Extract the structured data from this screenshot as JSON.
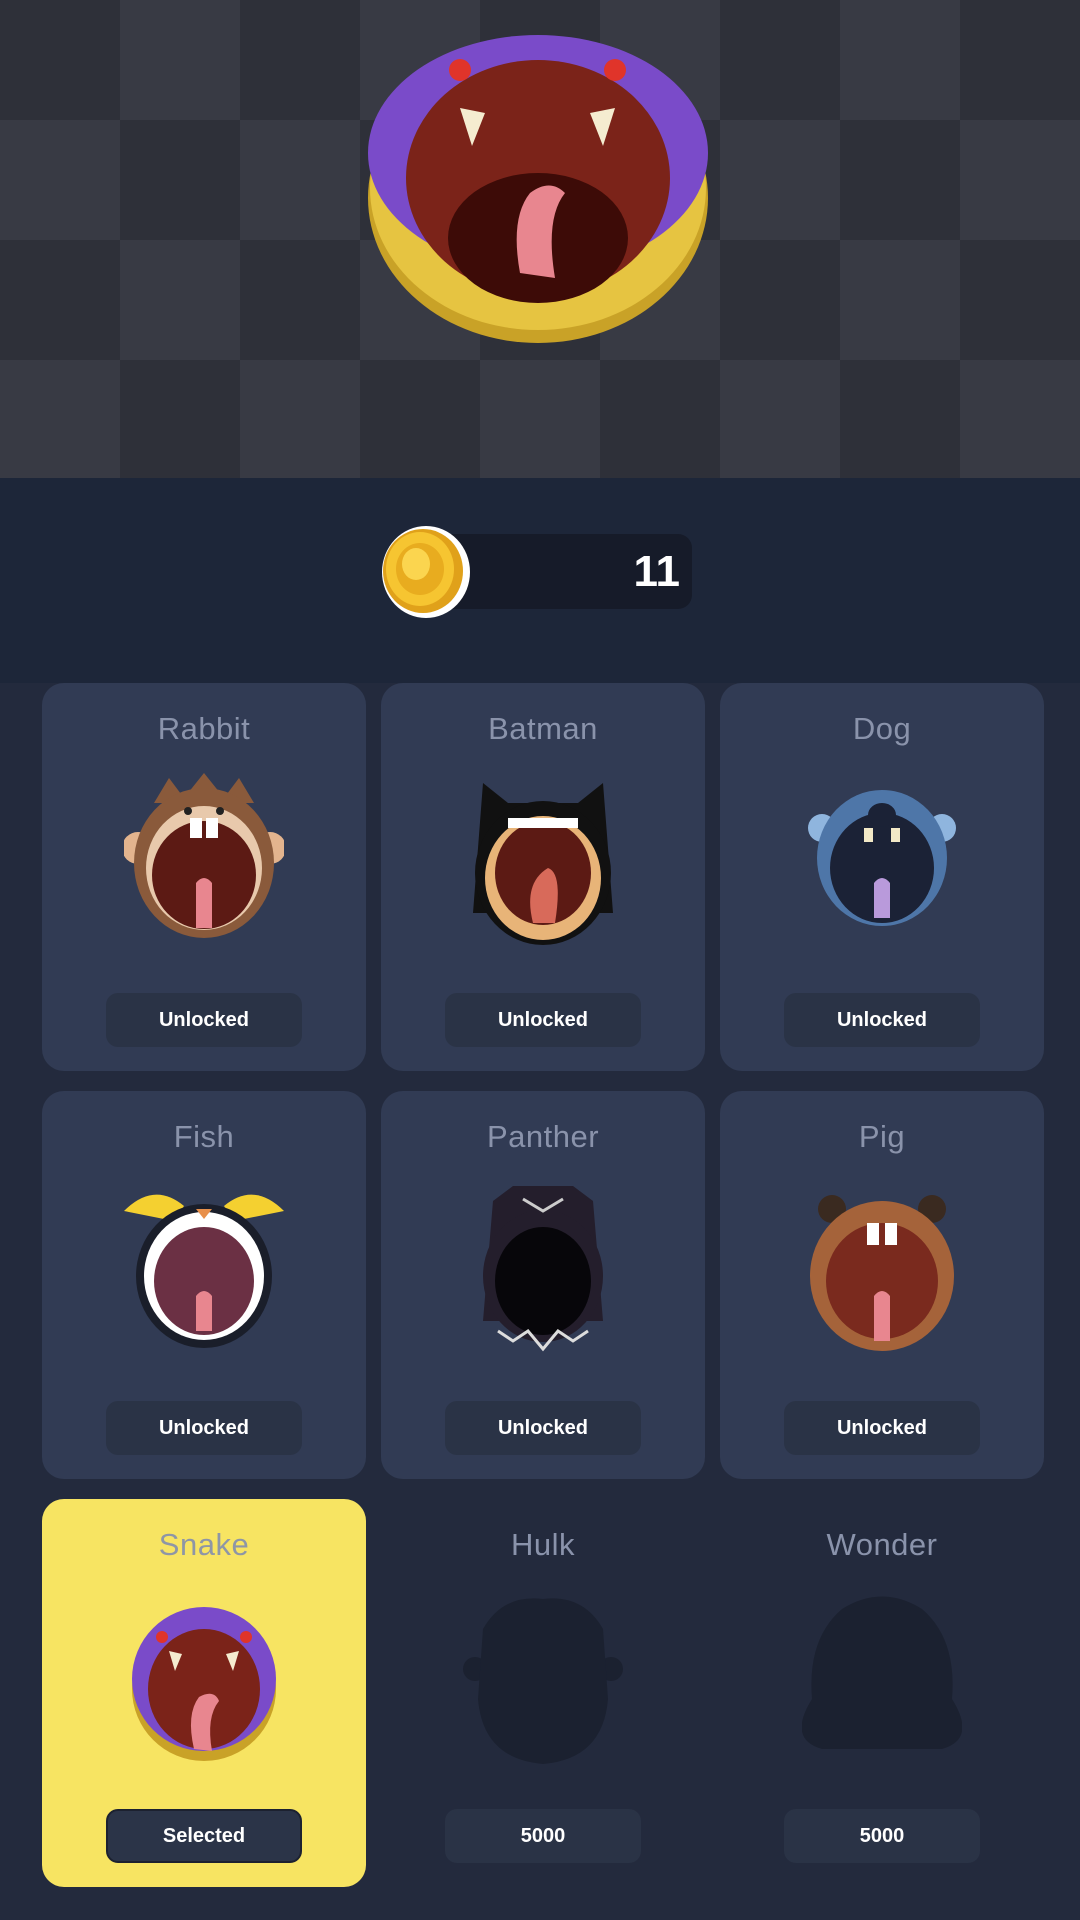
{
  "coins": {
    "value": "11"
  },
  "skins": [
    {
      "name": "Rabbit",
      "status": "Unlocked"
    },
    {
      "name": "Batman",
      "status": "Unlocked"
    },
    {
      "name": "Dog",
      "status": "Unlocked"
    },
    {
      "name": "Fish",
      "status": "Unlocked"
    },
    {
      "name": "Panther",
      "status": "Unlocked"
    },
    {
      "name": "Pig",
      "status": "Unlocked"
    },
    {
      "name": "Snake",
      "status": "Selected"
    },
    {
      "name": "Hulk",
      "status": "5000"
    },
    {
      "name": "Wonder",
      "status": "5000"
    }
  ],
  "colors": {
    "background": "#232a3d",
    "card": "#313b54",
    "selected_card": "#f7e462",
    "button": "#2a3346"
  }
}
